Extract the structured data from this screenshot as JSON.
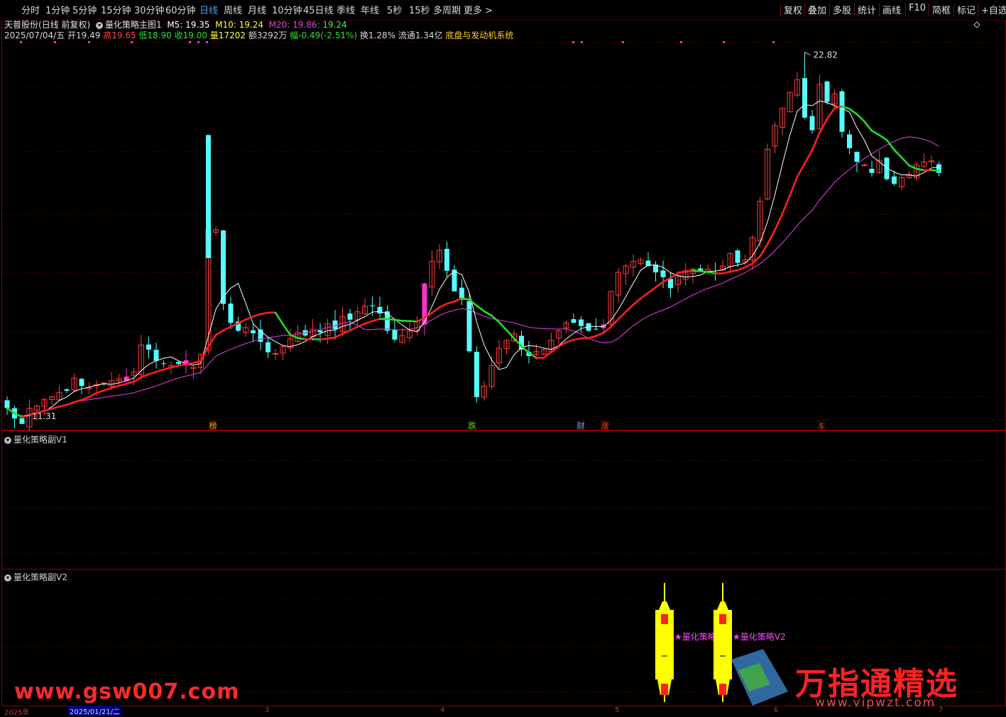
{
  "toolbar": {
    "periods": [
      "分时",
      "1分钟",
      "5分钟",
      "15分钟",
      "30分钟",
      "60分钟",
      "日线",
      "周线",
      "月线",
      "10分钟",
      "45日线",
      "季线",
      "年线",
      "5秒",
      "15秒",
      "多周期",
      "更多 >"
    ],
    "active_period": "日线",
    "tools": [
      "复权",
      "叠加",
      "多股",
      "统计",
      "画线",
      "F10",
      "简框",
      "标记",
      "+自选"
    ]
  },
  "header": {
    "stock_name": "天普股份",
    "mode": "(日线 前复权)",
    "indicator_name": "量化策略主图1",
    "ma5_label": "M5: 19.35",
    "ma10_label": "M10: 19.24",
    "ma20_label": "M20: 19.86",
    "ma_extra": ": 19.24",
    "date": "2025/07/04/五",
    "open": "开19.49",
    "high": "高19.65",
    "low": "低18.90",
    "close": "收19.00",
    "volume": "量17202",
    "amount": "额3292万",
    "change": "幅-0.49(-2.51%)",
    "turnover": "换1.28%",
    "float": "流通1.34亿",
    "system": "底盘与发动机系统"
  },
  "annotations": {
    "high_label": "22.82",
    "low_label": "11.31",
    "markers": [
      {
        "text": "榜",
        "color": "#ff9900"
      },
      {
        "text": "跌",
        "color": "#33dd33"
      },
      {
        "text": "财",
        "color": "#4fa4ff"
      },
      {
        "text": "涨",
        "color": "#ff3333"
      },
      {
        "text": "$",
        "color": "#ff3333"
      }
    ]
  },
  "panes": {
    "sub1": "量化策略副V1",
    "sub2": "量化策略副V2",
    "sub2_labels": [
      "★量化策略",
      "★量化策略V2"
    ]
  },
  "datebar": {
    "year_label": "2025年",
    "selected_date": "2025/01/21/二",
    "months": [
      "3",
      "4",
      "5",
      "6",
      "7"
    ]
  },
  "watermarks": {
    "left": "www.gsw007.com",
    "right_title": "万指通精选",
    "right_url": "www.vipwzt.com"
  },
  "colors": {
    "up": "#ff3b3b",
    "down": "#54ffff",
    "ma5": "#ffffff",
    "ma10": "#ff2020",
    "ma20": "#cc33cc",
    "ma10_green": "#22dd22",
    "pink": "#ff33cc",
    "accent": "#3fa9ff"
  },
  "chart_data": {
    "type": "candlestick",
    "price_range": [
      11.0,
      23.8
    ],
    "closes": [
      11.55,
      11.22,
      11.05,
      11.55,
      11.62,
      11.82,
      11.92,
      12.05,
      12.1,
      12.5,
      12.25,
      12.2,
      12.3,
      12.35,
      12.42,
      12.48,
      12.55,
      12.7,
      13.55,
      13.4,
      13.05,
      12.95,
      12.9,
      12.95,
      12.9,
      12.85,
      13.25,
      17.2,
      17.2,
      14.85,
      14.25,
      14.0,
      14.1,
      13.92,
      13.65,
      13.32,
      13.28,
      13.5,
      13.75,
      13.95,
      13.85,
      14.05,
      13.95,
      14.22,
      14.05,
      14.45,
      14.35,
      14.6,
      14.78,
      14.78,
      14.55,
      14.0,
      13.72,
      13.85,
      14.0,
      14.3,
      15.5,
      16.2,
      16.55,
      15.9,
      15.25,
      14.98,
      13.35,
      11.9,
      12.25,
      12.9,
      13.45,
      13.7,
      13.9,
      13.4,
      13.2,
      13.35,
      13.4,
      13.7,
      14.0,
      14.25,
      14.25,
      14.15,
      14.0,
      14.05,
      14.2,
      15.25,
      15.85,
      16.05,
      16.2,
      16.25,
      16.05,
      15.85,
      15.7,
      15.35,
      15.75,
      15.85,
      15.95,
      15.9,
      15.95,
      15.8,
      16.05,
      16.45,
      16.15,
      16.25,
      16.95,
      18.1,
      19.75,
      20.5,
      21.05,
      21.55,
      21.95,
      20.75,
      20.35,
      21.8,
      21.25,
      21.5,
      20.3,
      19.78,
      19.35,
      19.25,
      19.0,
      19.4,
      18.8,
      18.65,
      18.85,
      18.95,
      19.25,
      19.35,
      19.38,
      19.0
    ],
    "series": [
      {
        "name": "M5"
      },
      {
        "name": "M10"
      },
      {
        "name": "M20"
      }
    ],
    "high": 22.82,
    "low": 11.31
  }
}
